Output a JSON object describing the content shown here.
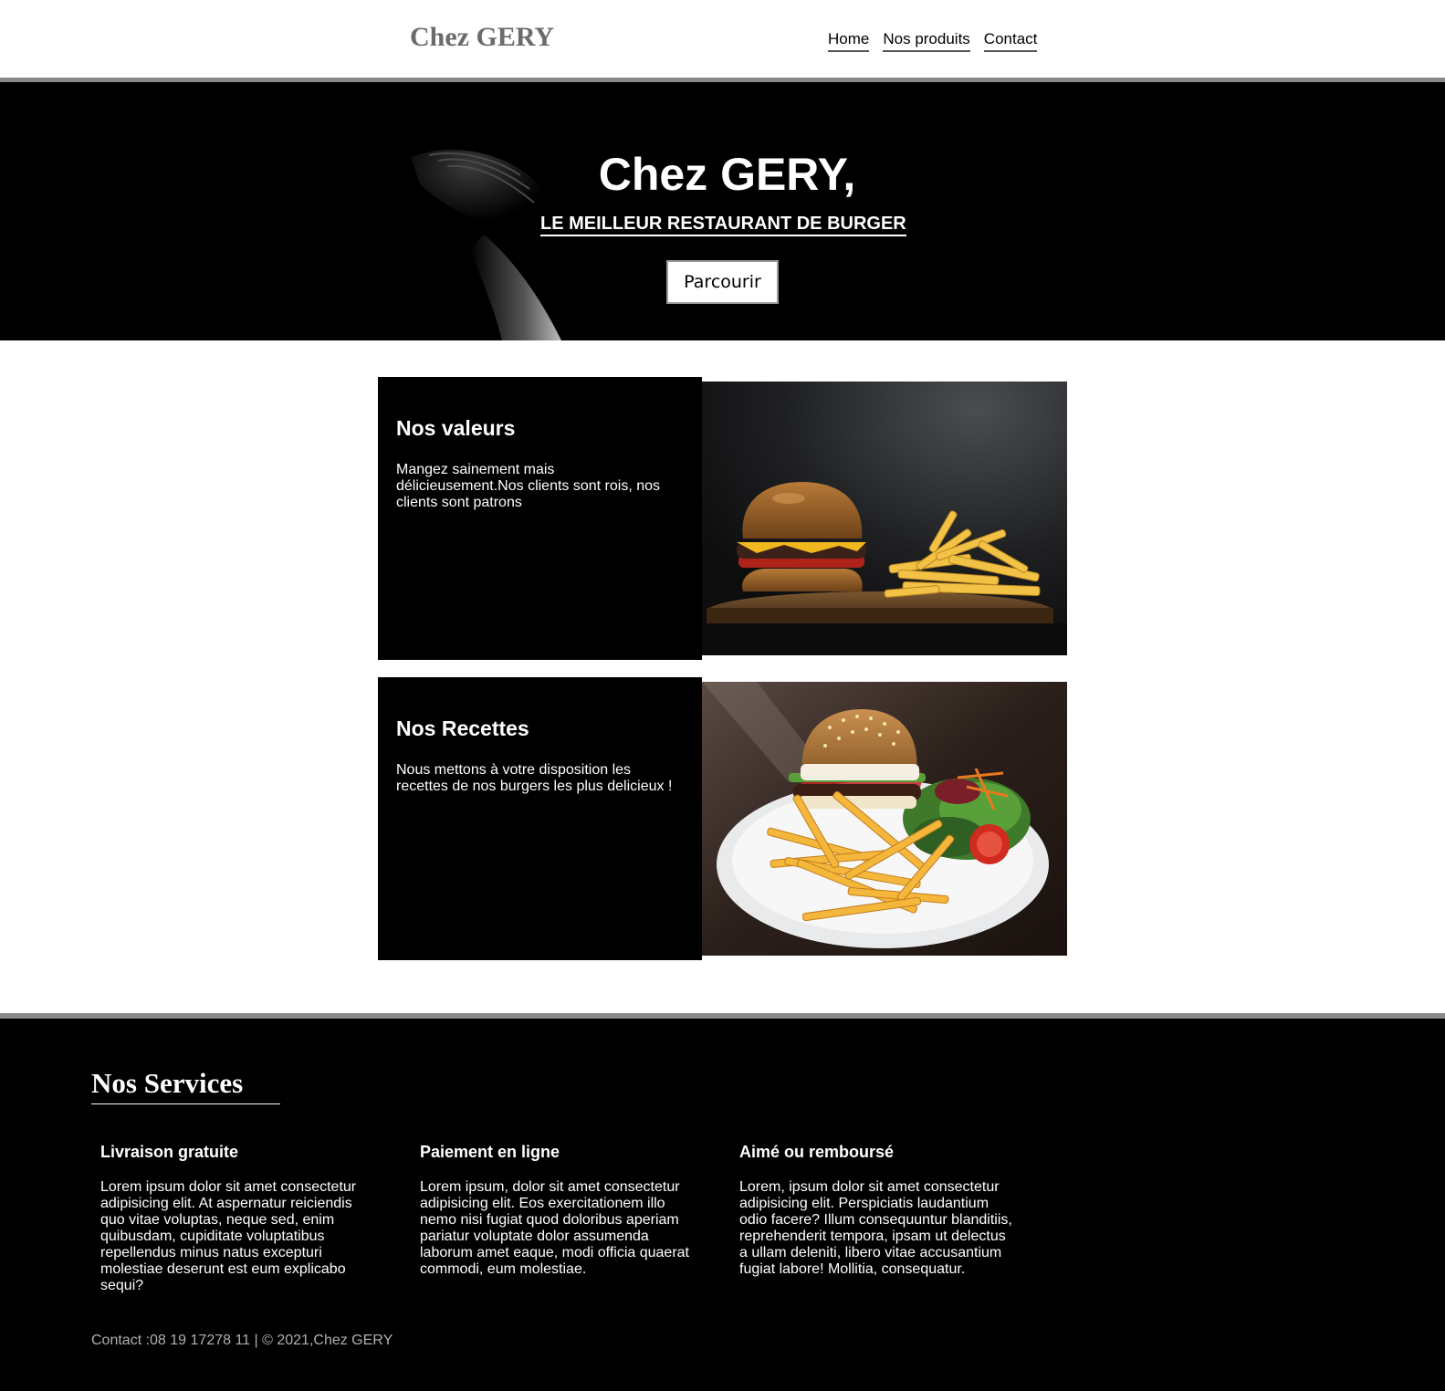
{
  "header": {
    "brand": "Chez GERY",
    "nav": [
      {
        "label": "Home"
      },
      {
        "label": "Nos produits"
      },
      {
        "label": "Contact"
      }
    ]
  },
  "hero": {
    "title": "Chez GERY,",
    "subtitle": "LE MEILLEUR RESTAURANT DE BURGER",
    "button": "Parcourir"
  },
  "cards": [
    {
      "title": "Nos valeurs",
      "body": "Mangez sainement mais délicieusement.Nos clients sont rois, nos clients sont patrons"
    },
    {
      "title": "Nos Recettes",
      "body": "Nous mettons à votre disposition les recettes de nos burgers les plus delicieux !"
    }
  ],
  "footer": {
    "services_title": "Nos Services",
    "services": [
      {
        "title": "Livraison gratuite",
        "body": "Lorem ipsum dolor sit amet consectetur adipisicing elit. At aspernatur reiciendis quo vitae voluptas, neque sed, enim quibusdam, cupiditate voluptatibus repellendus minus natus excepturi molestiae deserunt est eum explicabo sequi?"
      },
      {
        "title": "Paiement en ligne",
        "body": "Lorem ipsum, dolor sit amet consectetur adipisicing elit. Eos exercitationem illo nemo nisi fugiat quod doloribus aperiam pariatur voluptate dolor assumenda laborum amet eaque, modi officia quaerat commodi, eum molestiae."
      },
      {
        "title": "Aimé ou remboursé",
        "body": "Lorem, ipsum dolor sit amet consectetur adipisicing elit. Perspiciatis laudantium odio facere? Illum consequuntur blanditiis, reprehenderit tempora, ipsam ut delectus a ullam deleniti, libero vitae accusantium fugiat labore! Mollitia, consequatur."
      }
    ],
    "contact": "Contact :08 19 17278 11 | © 2021,Chez GERY"
  }
}
